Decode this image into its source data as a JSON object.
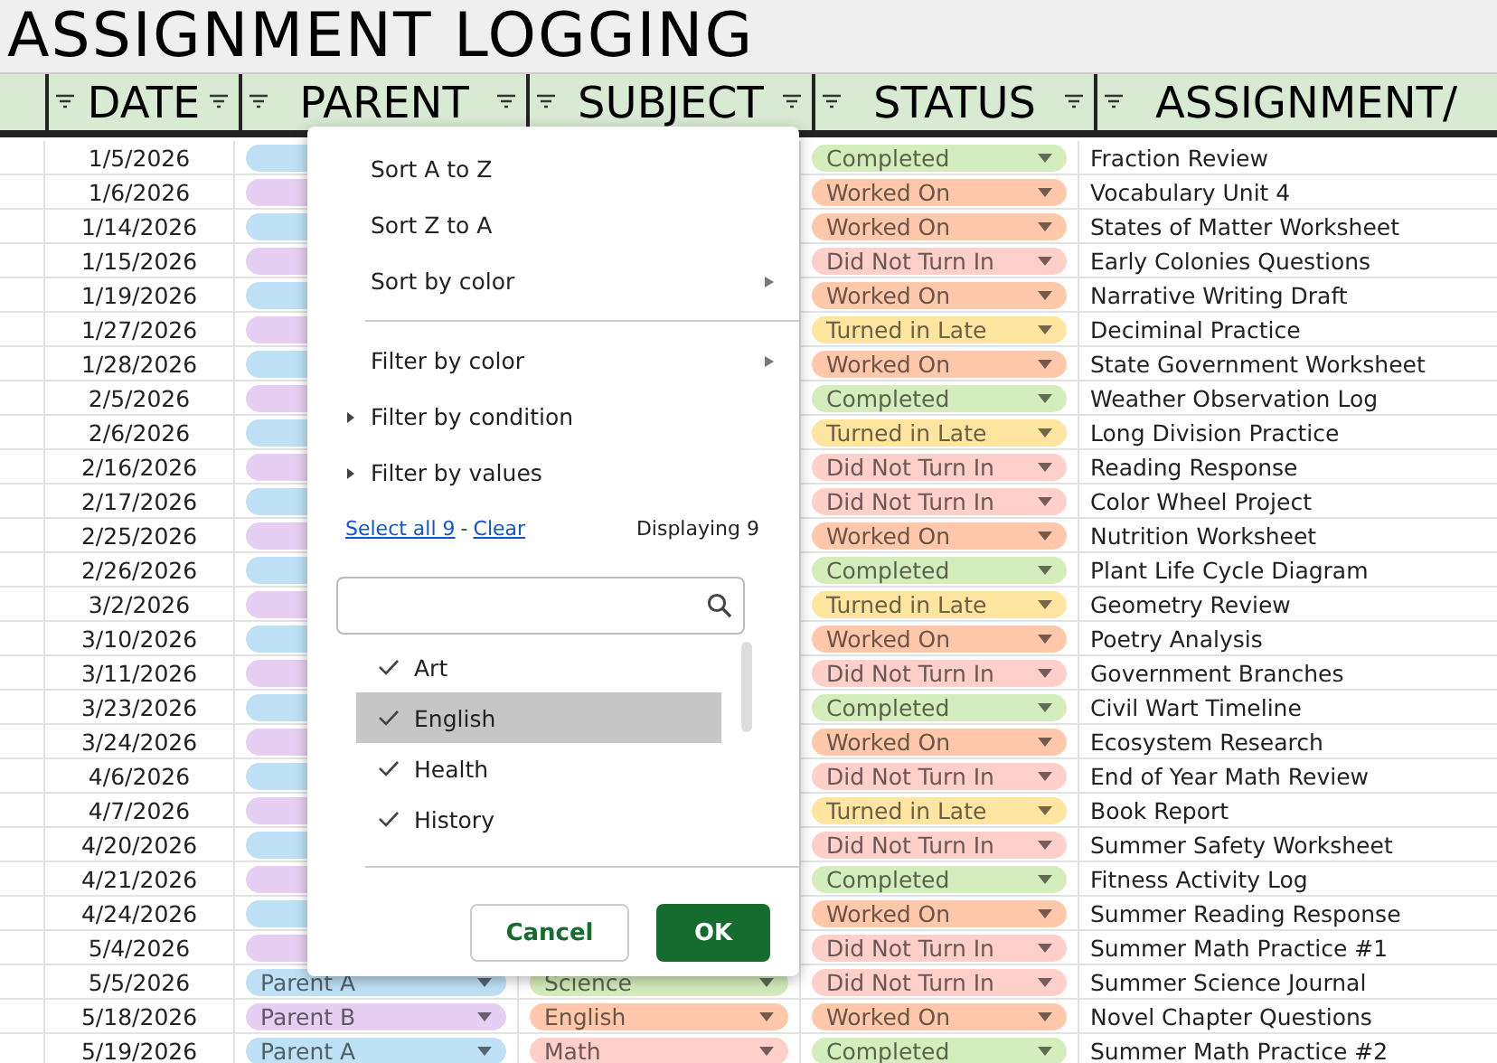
{
  "title": "ASSIGNMENT LOGGING",
  "columns": [
    {
      "label": "DATE"
    },
    {
      "label": "PARENT"
    },
    {
      "label": "SUBJECT"
    },
    {
      "label": "STATUS"
    },
    {
      "label": "ASSIGNMENT/"
    }
  ],
  "rows": [
    {
      "date": "1/5/2026",
      "parent": {
        "color": "#bfe1f6"
      },
      "status": {
        "label": "Completed",
        "color": "#d4edbc"
      },
      "assignment": "Fraction Review"
    },
    {
      "date": "1/6/2026",
      "parent": {
        "color": "#e6cff2"
      },
      "status": {
        "label": "Worked On",
        "color": "#ffc8aa"
      },
      "assignment": "Vocabulary Unit 4"
    },
    {
      "date": "1/14/2026",
      "parent": {
        "color": "#bfe1f6"
      },
      "status": {
        "label": "Worked On",
        "color": "#ffc8aa"
      },
      "assignment": "States of Matter Worksheet"
    },
    {
      "date": "1/15/2026",
      "parent": {
        "color": "#e6cff2"
      },
      "status": {
        "label": "Did Not Turn In",
        "color": "#ffcfc9"
      },
      "assignment": "Early Colonies Questions"
    },
    {
      "date": "1/19/2026",
      "parent": {
        "color": "#bfe1f6"
      },
      "status": {
        "label": "Worked On",
        "color": "#ffc8aa"
      },
      "assignment": "Narrative Writing Draft"
    },
    {
      "date": "1/27/2026",
      "parent": {
        "color": "#e6cff2"
      },
      "status": {
        "label": "Turned in Late",
        "color": "#ffe5a0"
      },
      "assignment": "Deciminal Practice"
    },
    {
      "date": "1/28/2026",
      "parent": {
        "color": "#bfe1f6"
      },
      "status": {
        "label": "Worked On",
        "color": "#ffc8aa"
      },
      "assignment": "State Government Worksheet"
    },
    {
      "date": "2/5/2026",
      "parent": {
        "color": "#e6cff2"
      },
      "status": {
        "label": "Completed",
        "color": "#d4edbc"
      },
      "assignment": "Weather Observation Log"
    },
    {
      "date": "2/6/2026",
      "parent": {
        "color": "#bfe1f6"
      },
      "status": {
        "label": "Turned in Late",
        "color": "#ffe5a0"
      },
      "assignment": "Long Division Practice"
    },
    {
      "date": "2/16/2026",
      "parent": {
        "color": "#e6cff2"
      },
      "status": {
        "label": "Did Not Turn In",
        "color": "#ffcfc9"
      },
      "assignment": "Reading Response"
    },
    {
      "date": "2/17/2026",
      "parent": {
        "color": "#bfe1f6"
      },
      "status": {
        "label": "Did Not Turn In",
        "color": "#ffcfc9"
      },
      "assignment": "Color Wheel Project"
    },
    {
      "date": "2/25/2026",
      "parent": {
        "color": "#e6cff2"
      },
      "status": {
        "label": "Worked On",
        "color": "#ffc8aa"
      },
      "assignment": "Nutrition Worksheet"
    },
    {
      "date": "2/26/2026",
      "parent": {
        "color": "#bfe1f6"
      },
      "status": {
        "label": "Completed",
        "color": "#d4edbc"
      },
      "assignment": "Plant Life Cycle Diagram"
    },
    {
      "date": "3/2/2026",
      "parent": {
        "color": "#e6cff2"
      },
      "status": {
        "label": "Turned in Late",
        "color": "#ffe5a0"
      },
      "assignment": "Geometry Review"
    },
    {
      "date": "3/10/2026",
      "parent": {
        "color": "#bfe1f6"
      },
      "status": {
        "label": "Worked On",
        "color": "#ffc8aa"
      },
      "assignment": "Poetry Analysis"
    },
    {
      "date": "3/11/2026",
      "parent": {
        "color": "#e6cff2"
      },
      "status": {
        "label": "Did Not Turn In",
        "color": "#ffcfc9"
      },
      "assignment": "Government Branches"
    },
    {
      "date": "3/23/2026",
      "parent": {
        "color": "#bfe1f6"
      },
      "status": {
        "label": "Completed",
        "color": "#d4edbc"
      },
      "assignment": "Civil Wart Timeline"
    },
    {
      "date": "3/24/2026",
      "parent": {
        "color": "#e6cff2"
      },
      "status": {
        "label": "Worked On",
        "color": "#ffc8aa"
      },
      "assignment": "Ecosystem Research"
    },
    {
      "date": "4/6/2026",
      "parent": {
        "color": "#bfe1f6"
      },
      "status": {
        "label": "Did Not Turn In",
        "color": "#ffcfc9"
      },
      "assignment": "End of Year Math Review"
    },
    {
      "date": "4/7/2026",
      "parent": {
        "color": "#e6cff2"
      },
      "status": {
        "label": "Turned in Late",
        "color": "#ffe5a0"
      },
      "assignment": "Book Report"
    },
    {
      "date": "4/20/2026",
      "parent": {
        "color": "#bfe1f6"
      },
      "status": {
        "label": "Did Not Turn In",
        "color": "#ffcfc9"
      },
      "assignment": "Summer Safety Worksheet"
    },
    {
      "date": "4/21/2026",
      "parent": {
        "color": "#e6cff2"
      },
      "status": {
        "label": "Completed",
        "color": "#d4edbc"
      },
      "assignment": "Fitness Activity Log"
    },
    {
      "date": "4/24/2026",
      "parent": {
        "color": "#bfe1f6"
      },
      "status": {
        "label": "Worked On",
        "color": "#ffc8aa"
      },
      "assignment": "Summer Reading Response"
    },
    {
      "date": "5/4/2026",
      "parent": {
        "color": "#e6cff2"
      },
      "status": {
        "label": "Did Not Turn In",
        "color": "#ffcfc9"
      },
      "assignment": "Summer Math Practice #1"
    },
    {
      "date": "5/5/2026",
      "parent": {
        "label": "Parent A",
        "color": "#bfe1f6"
      },
      "subject": {
        "label": "Science",
        "color": "#d4edbc"
      },
      "status": {
        "label": "Did Not Turn In",
        "color": "#ffcfc9"
      },
      "assignment": "Summer Science Journal"
    },
    {
      "date": "5/18/2026",
      "parent": {
        "label": "Parent B",
        "color": "#e6cff2"
      },
      "subject": {
        "label": "English",
        "color": "#ffc8aa"
      },
      "status": {
        "label": "Worked On",
        "color": "#ffc8aa"
      },
      "assignment": "Novel Chapter Questions"
    },
    {
      "date": "5/19/2026",
      "parent": {
        "label": "Parent A",
        "color": "#bfe1f6"
      },
      "subject": {
        "label": "Math",
        "color": "#ffcfc9"
      },
      "status": {
        "label": "Completed",
        "color": "#d4edbc"
      },
      "assignment": "Summer Math Practice #2"
    }
  ],
  "filter_menu": {
    "sort_items": [
      {
        "label": "Sort A to Z",
        "kind": "plain"
      },
      {
        "label": "Sort Z to A",
        "kind": "plain"
      },
      {
        "label": "Sort by color",
        "kind": "submenu"
      }
    ],
    "filter_items": [
      {
        "label": "Filter by color",
        "kind": "submenu"
      },
      {
        "label": "Filter by condition",
        "kind": "expander"
      },
      {
        "label": "Filter by values",
        "kind": "expander"
      }
    ],
    "select_all": "Select all 9",
    "separator": "-",
    "clear": "Clear",
    "count": "Displaying 9",
    "values": [
      {
        "label": "Art",
        "checked": true,
        "selected": false
      },
      {
        "label": "English",
        "checked": true,
        "selected": true
      },
      {
        "label": "Health",
        "checked": true,
        "selected": false
      },
      {
        "label": "History",
        "checked": true,
        "selected": false
      }
    ],
    "cancel": "Cancel",
    "ok": "OK"
  }
}
